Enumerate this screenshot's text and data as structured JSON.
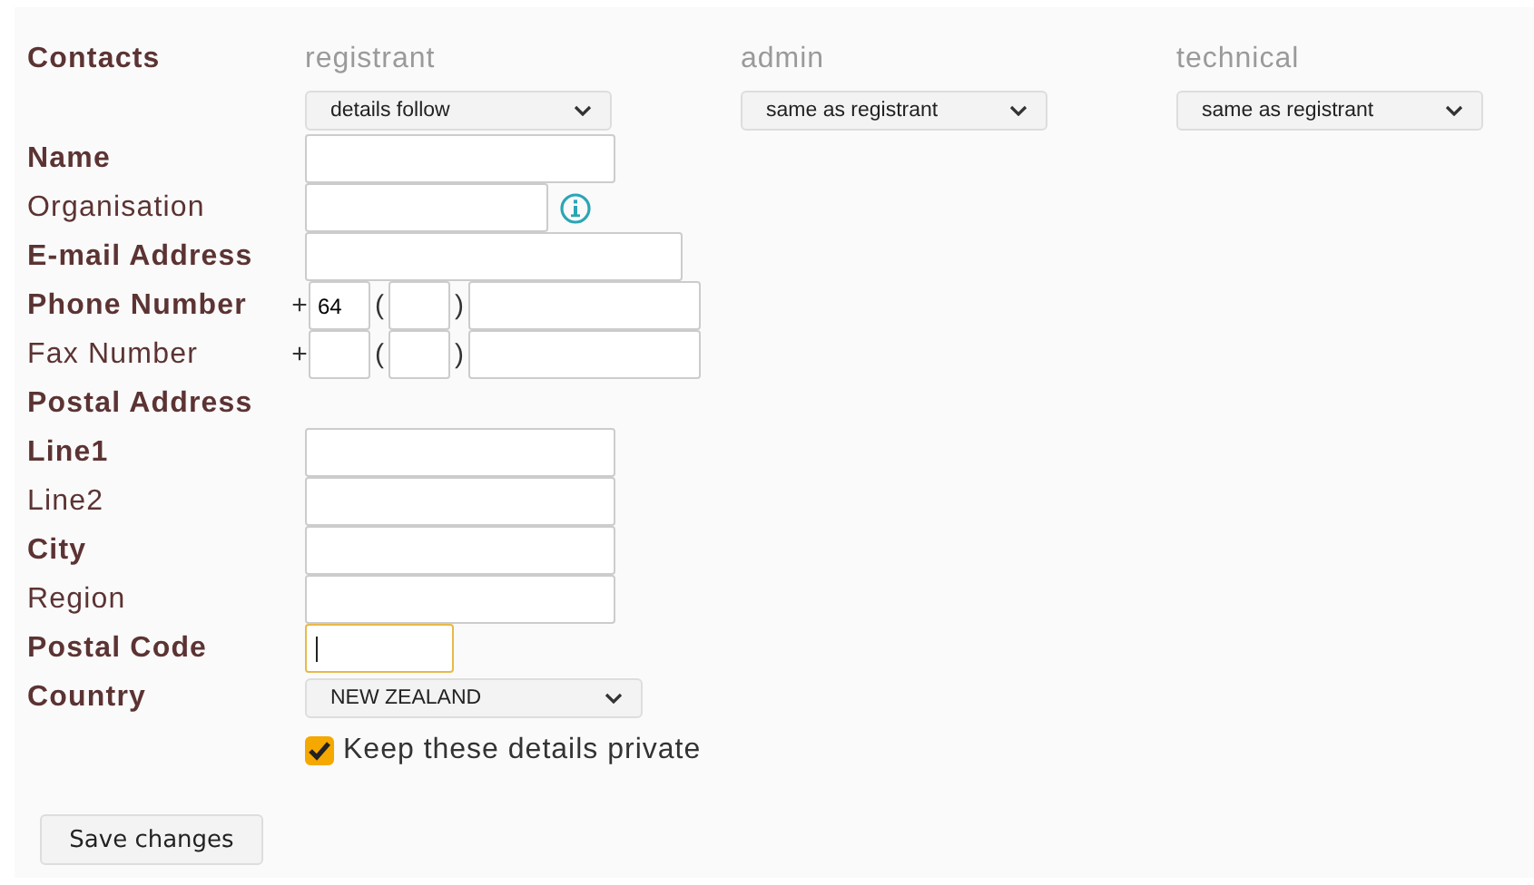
{
  "contacts": {
    "label": "Contacts",
    "roles": [
      {
        "heading": "registrant",
        "choice": "details follow"
      },
      {
        "heading": "admin",
        "choice": "same as registrant"
      },
      {
        "heading": "technical",
        "choice": "same as registrant"
      }
    ]
  },
  "fields": [
    {
      "kind": "text",
      "label": "Name",
      "required": true
    },
    {
      "kind": "text_info",
      "label": "Organisation",
      "required": false
    },
    {
      "kind": "wide",
      "label": "E-mail Address",
      "required": true
    },
    {
      "kind": "phone",
      "label": "Phone Number",
      "required": true,
      "plus": "+",
      "open": "(",
      "close": ")",
      "country_code": "64"
    },
    {
      "kind": "phone",
      "label": "Fax Number",
      "required": false,
      "plus": "+",
      "open": "(",
      "close": ")"
    },
    {
      "kind": "section",
      "label": "Postal Address",
      "required": true
    },
    {
      "kind": "text",
      "label": "Line1",
      "required": true
    },
    {
      "kind": "text",
      "label": "Line2",
      "required": false
    },
    {
      "kind": "text",
      "label": "City",
      "required": true
    },
    {
      "kind": "text",
      "label": "Region",
      "required": false
    },
    {
      "kind": "short",
      "label": "Postal Code",
      "required": true,
      "focused": true
    },
    {
      "kind": "select",
      "label": "Country",
      "required": true,
      "value": "NEW ZEALAND"
    },
    {
      "kind": "checkbox",
      "label": "Keep these details private",
      "checked": true
    }
  ],
  "save_button": "Save changes"
}
